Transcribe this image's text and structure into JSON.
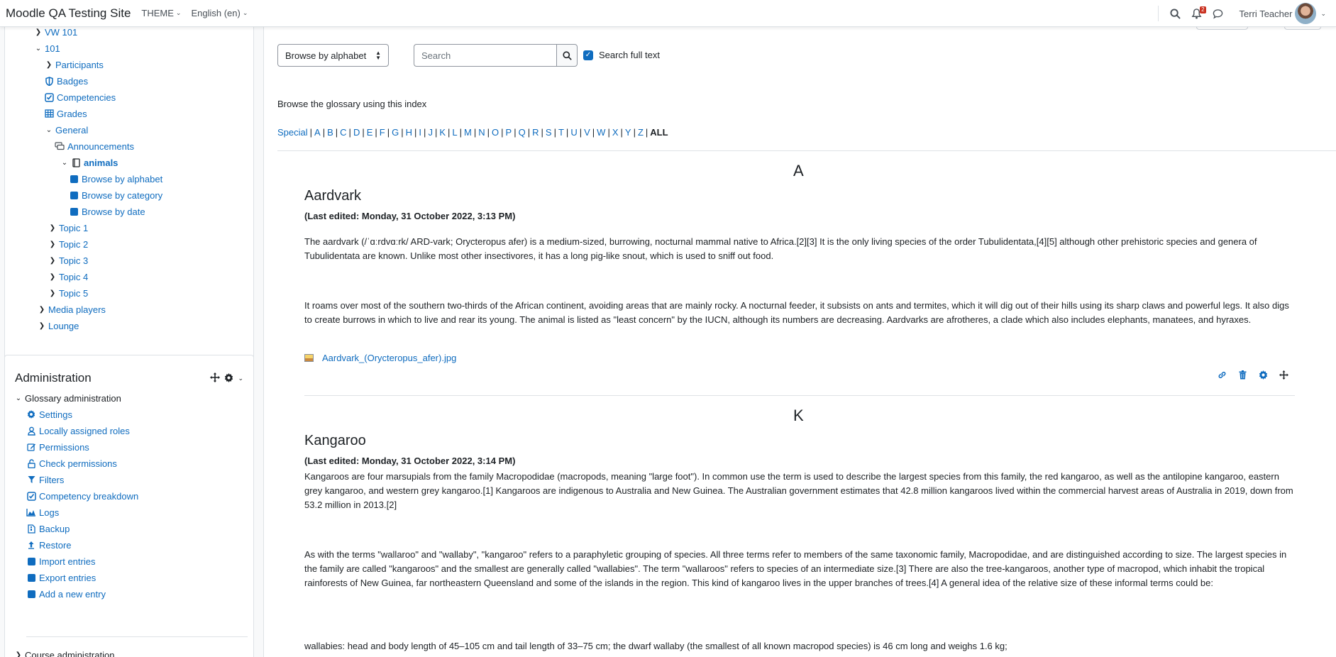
{
  "navbar": {
    "site_name": "Moodle QA Testing Site",
    "theme_menu": "THEME",
    "language_menu": "English (en)",
    "notification_count": "2",
    "user_name": "Terri Teacher"
  },
  "nav_tree": {
    "items": [
      {
        "label": "VW 101"
      },
      {
        "label": "101"
      },
      {
        "label": "Participants"
      },
      {
        "label": "Badges"
      },
      {
        "label": "Competencies"
      },
      {
        "label": "Grades"
      },
      {
        "label": "General"
      },
      {
        "label": "Announcements"
      },
      {
        "label": "animals"
      },
      {
        "label": "Browse by alphabet"
      },
      {
        "label": "Browse by category"
      },
      {
        "label": "Browse by date"
      },
      {
        "label": "Topic 1"
      },
      {
        "label": "Topic 2"
      },
      {
        "label": "Topic 3"
      },
      {
        "label": "Topic 4"
      },
      {
        "label": "Topic 5"
      },
      {
        "label": "Media players"
      },
      {
        "label": "Lounge"
      }
    ]
  },
  "admin": {
    "title": "Administration",
    "glossary_admin": "Glossary administration",
    "items": [
      {
        "label": "Settings"
      },
      {
        "label": "Locally assigned roles"
      },
      {
        "label": "Permissions"
      },
      {
        "label": "Check permissions"
      },
      {
        "label": "Filters"
      },
      {
        "label": "Competency breakdown"
      },
      {
        "label": "Logs"
      },
      {
        "label": "Backup"
      },
      {
        "label": "Restore"
      },
      {
        "label": "Import entries"
      },
      {
        "label": "Export entries"
      },
      {
        "label": "Add a new entry"
      }
    ],
    "course_admin": "Course administration"
  },
  "glossary": {
    "browse_select": "Browse by alphabet",
    "search_placeholder": "Search",
    "search_full_text": "Search full text",
    "browse_label": "Browse the glossary using this index",
    "alphabet": [
      "Special",
      "A",
      "B",
      "C",
      "D",
      "E",
      "F",
      "G",
      "H",
      "I",
      "J",
      "K",
      "L",
      "M",
      "N",
      "O",
      "P",
      "Q",
      "R",
      "S",
      "T",
      "U",
      "V",
      "W",
      "X",
      "Y",
      "Z"
    ],
    "alphabet_current": "ALL"
  },
  "entries": {
    "aardvark": {
      "letter": "A",
      "title": "Aardvark",
      "edited": "(Last edited: Monday, 31 October 2022, 3:13 PM)",
      "para1": "The aardvark (/ˈɑːrdvɑːrk/ ARD-vark; Orycteropus afer) is a medium-sized, burrowing, nocturnal mammal native to Africa.[2][3] It is the only living species of the order Tubulidentata,[4][5] although other prehistoric species and genera of Tubulidentata are known. Unlike most other insectivores, it has a long pig-like snout, which is used to sniff out food.",
      "para2": "It roams over most of the southern two-thirds of the African continent, avoiding areas that are mainly rocky. A nocturnal feeder, it subsists on ants and termites, which it will dig out of their hills using its sharp claws and powerful legs. It also digs to create burrows in which to live and rear its young. The animal is listed as \"least concern\" by the IUCN, although its numbers are decreasing. Aardvarks are afrotheres, a clade which also includes elephants, manatees, and hyraxes.",
      "attachment": "Aardvark_(Orycteropus_afer).jpg"
    },
    "kangaroo": {
      "letter": "K",
      "title": "Kangaroo",
      "edited": "(Last edited: Monday, 31 October 2022, 3:14 PM)",
      "para1": "Kangaroos are four marsupials from the family Macropodidae (macropods, meaning \"large foot\"). In common use the term is used to describe the largest species from this family, the red kangaroo, as well as the antilopine kangaroo, eastern grey kangaroo, and western grey kangaroo.[1] Kangaroos are indigenous to Australia and New Guinea. The Australian government estimates that 42.8 million kangaroos lived within the commercial harvest areas of Australia in 2019, down from 53.2 million in 2013.[2]",
      "para2": "As with the terms \"wallaroo\" and \"wallaby\", \"kangaroo\" refers to a paraphyletic grouping of species. All three terms refer to members of the same taxonomic family, Macropodidae, and are distinguished according to size. The largest species in the family are called \"kangaroos\" and the smallest are generally called \"wallabies\". The term \"wallaroos\" refers to species of an intermediate size.[3] There are also the tree-kangaroos, another type of macropod, which inhabit the tropical rainforests of New Guinea, far northeastern Queensland and some of the islands in the region. This kind of kangaroo lives in the upper branches of trees.[4] A general idea of the relative size of these informal terms could be:",
      "para3": "wallabies: head and body length of 45–105 cm and tail length of 33–75 cm; the dwarf wallaby (the smallest of all known macropod species) is 46 cm long and weighs 1.6 kg;"
    }
  },
  "colors": {
    "link": "#0f6cbf",
    "text": "#1d2125",
    "drawer_bg": "#f8f9fa",
    "border": "#dee2e6"
  }
}
